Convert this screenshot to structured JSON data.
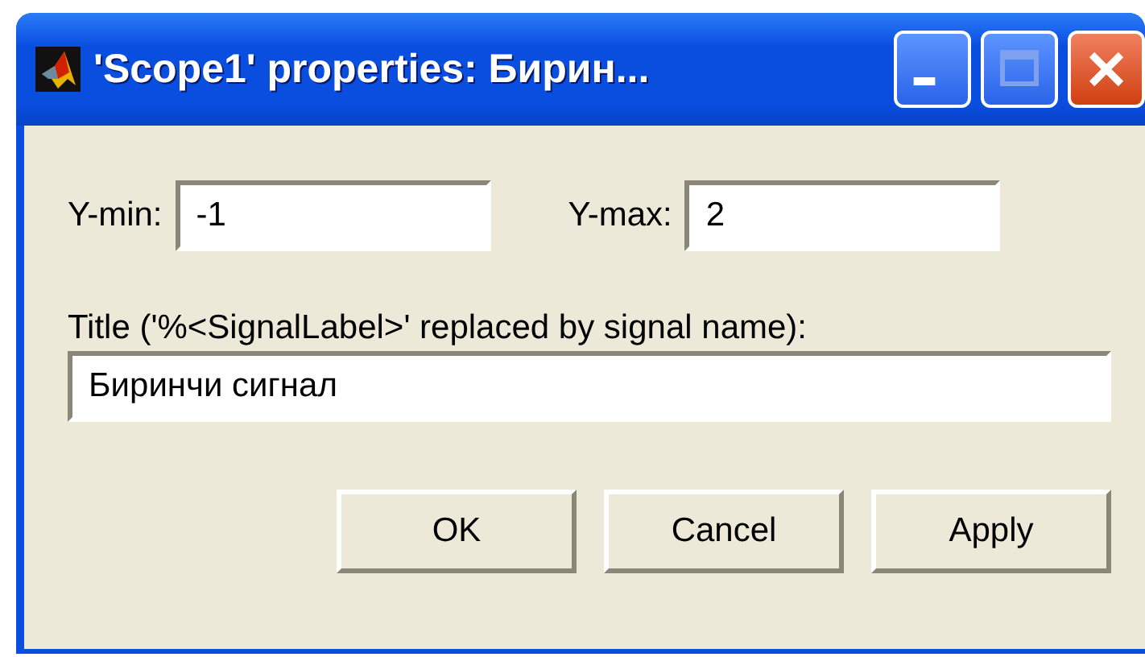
{
  "window": {
    "title": "'Scope1' properties: Бирин..."
  },
  "range_fields": [
    {
      "label": "Y-min:",
      "value": "-1"
    },
    {
      "label": "Y-max:",
      "value": "2"
    }
  ],
  "title_field": {
    "label": "Title ('%<SignalLabel>' replaced by signal name):",
    "value": "Биринчи сигнал"
  },
  "buttons": [
    "OK",
    "Cancel",
    "Apply"
  ]
}
